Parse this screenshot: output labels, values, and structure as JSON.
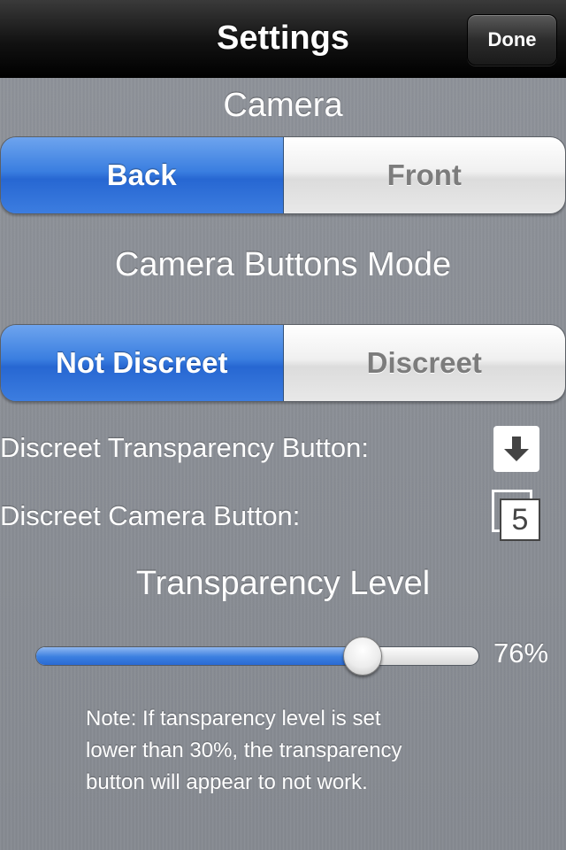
{
  "navbar": {
    "title": "Settings",
    "done_label": "Done"
  },
  "camera": {
    "title": "Camera",
    "options": [
      "Back",
      "Front"
    ],
    "selected": "Back"
  },
  "buttons_mode": {
    "title": "Camera Buttons Mode",
    "options": [
      "Not Discreet",
      "Discreet"
    ],
    "selected": "Not Discreet"
  },
  "discreet_transparency": {
    "label": "Discreet Transparency Button:",
    "icon": "down-arrow-icon"
  },
  "discreet_camera": {
    "label": "Discreet Camera Button:",
    "icon": "timer-5-icon",
    "icon_text": "5"
  },
  "transparency": {
    "title": "Transparency Level",
    "value": 0.76,
    "value_text": "76%"
  },
  "note": {
    "lines": [
      "Note: If tansparency level is set",
      "lower than 30%, the transparency",
      "button will appear to not work."
    ]
  },
  "colors": {
    "accent": "#3a7ee0",
    "nav_bg": "#121212"
  }
}
